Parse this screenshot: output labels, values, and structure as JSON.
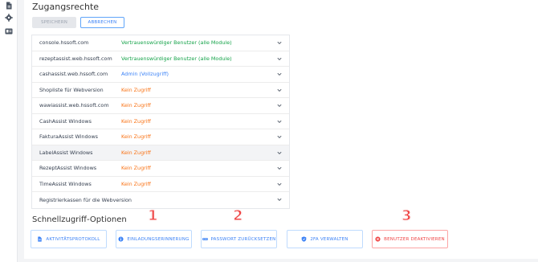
{
  "page": {
    "title": "Zugangsrechte"
  },
  "sidebar": {
    "icons": [
      "document-icon",
      "gear-icon",
      "id-card-icon"
    ]
  },
  "toolbar": {
    "save_label": "SPEICHERN",
    "cancel_label": "ABBRECHEN"
  },
  "access_rows": [
    {
      "name": "console.hssoft.com",
      "permission": "Vertrauenswürdiger Benutzer (alle Module)",
      "status": "green"
    },
    {
      "name": "rezeptassist.web.hssoft.com",
      "permission": "Vertrauenswürdiger Benutzer (alle Module)",
      "status": "green"
    },
    {
      "name": "cashassist.web.hssoft.com",
      "permission": "Admin (Vollzugriff)",
      "status": "blue"
    },
    {
      "name": "Shopliste für Webversion",
      "permission": "Kein Zugriff",
      "status": "orange"
    },
    {
      "name": "wawiassist.web.hssoft.com",
      "permission": "Kein Zugriff",
      "status": "orange"
    },
    {
      "name": "CashAssist Windows",
      "permission": "Kein Zugriff",
      "status": "orange"
    },
    {
      "name": "FakturaAssist Windows",
      "permission": "Kein Zugriff",
      "status": "orange"
    },
    {
      "name": "LabelAssist Windows",
      "permission": "Kein Zugriff",
      "status": "orange",
      "highlighted": true
    },
    {
      "name": "RezeptAssist Windows",
      "permission": "Kein Zugriff",
      "status": "orange"
    },
    {
      "name": "TimeAssist Windows",
      "permission": "Kein Zugriff",
      "status": "orange"
    },
    {
      "name": "Registrierkassen für die Webversion",
      "permission": "",
      "status": "none"
    }
  ],
  "quick_options": {
    "title": "Schnellzugriff-Optionen",
    "buttons": [
      {
        "label": "AKTIVITÄTSPROTOKOLL",
        "icon": "document-icon"
      },
      {
        "label": "EINLADUNGSERINNERUNG",
        "icon": "info-circle-icon"
      },
      {
        "label": "PASSWORT ZURÜCKSETZEN",
        "icon": "password-dots-icon"
      },
      {
        "label": "2FA VERWALTEN",
        "icon": "shield-icon"
      },
      {
        "label": "BENUTZER DEAKTIVIEREN",
        "icon": "close-circle-icon",
        "danger": true
      }
    ]
  },
  "annotations": [
    "1",
    "2",
    "3"
  ],
  "colors": {
    "accent": "#3b82f6",
    "green": "#16a34a",
    "orange": "#f97316",
    "danger": "#ef4444"
  }
}
